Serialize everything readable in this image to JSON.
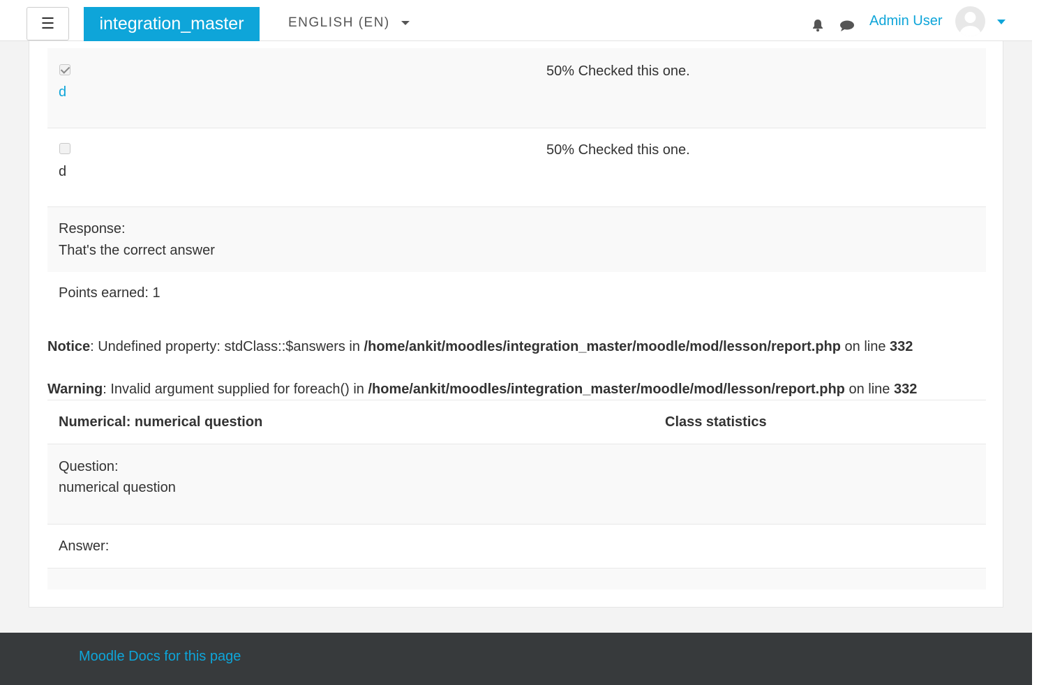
{
  "navbar": {
    "menu_icon": "hamburger-icon",
    "brand": "integration_master",
    "language": "ENGLISH (EN)",
    "notifications_icon": "bell-icon",
    "messages_icon": "chat-bubble-icon",
    "user_name": "Admin User",
    "avatar_icon": "user-avatar-icon"
  },
  "answers": [
    {
      "checked": true,
      "label": "d",
      "stat": "50% Checked this one."
    },
    {
      "checked": false,
      "label": "d",
      "stat": "50% Checked this one."
    }
  ],
  "response": {
    "label": "Response:",
    "text": "That's the correct answer"
  },
  "points": "Points earned: 1",
  "notice": {
    "kind": "Notice",
    "message": ": Undefined property: stdClass::$answers in ",
    "path": "/home/ankit/moodles/integration_master/moodle/mod/lesson/report.php",
    "online": " on line ",
    "line": "332"
  },
  "warning": {
    "kind": "Warning",
    "message": ": Invalid argument supplied for foreach() in ",
    "path": "/home/ankit/moodles/integration_master/moodle/mod/lesson/report.php",
    "online": " on line ",
    "line": "332"
  },
  "numerical": {
    "header": "Numerical: numerical question",
    "stats_header": "Class statistics",
    "question_label": "Question:",
    "question_text": "numerical question",
    "answer_label": "Answer:"
  },
  "footer": {
    "docs_link": "Moodle Docs for this page"
  },
  "colors": {
    "brand": "#0ea5d9",
    "link": "#0ea5d9",
    "footer_bg": "#373a3c"
  }
}
